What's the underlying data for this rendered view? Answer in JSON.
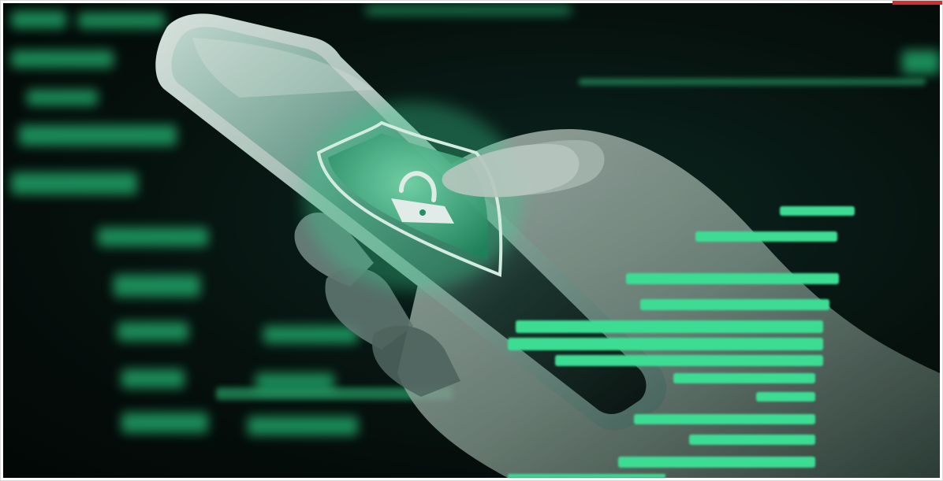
{
  "photo": {
    "subject": "hand-holding-smartphone",
    "screen_icon": "shield-lock-icon",
    "overlay": "code-lines"
  },
  "colors": {
    "background": "#06120e",
    "code_glow": "#35e08f",
    "shield_fill": "#2fbf86",
    "accent_badge": "#d32f2f"
  }
}
